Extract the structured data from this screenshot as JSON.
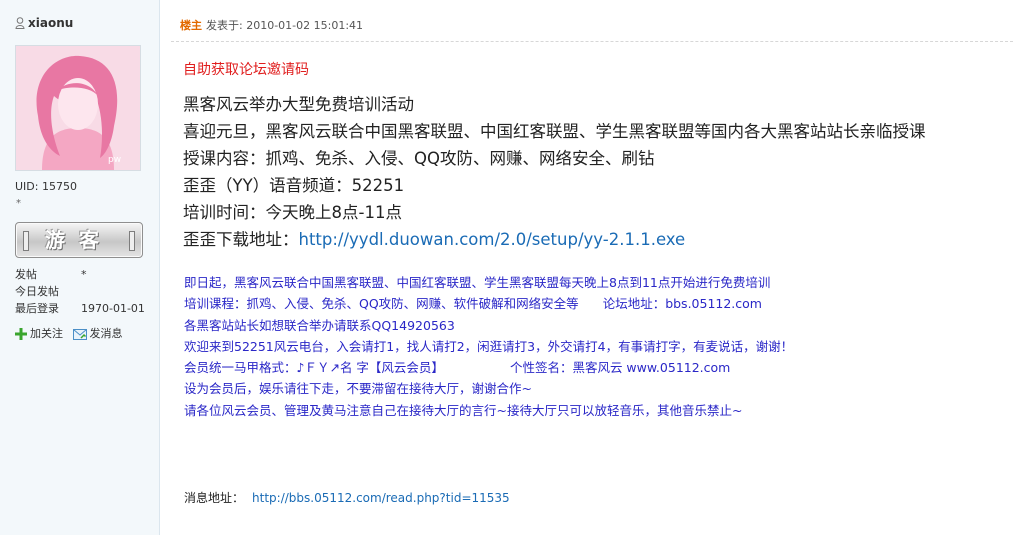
{
  "user": {
    "name": "xiaonu",
    "uid": "UID: 15750",
    "star": "*",
    "rank_badge": "游客",
    "stats": [
      {
        "label": "发帖",
        "value": "*"
      },
      {
        "label": "今日发帖",
        "value": ""
      },
      {
        "label": "最后登录",
        "value": "1970-01-01"
      }
    ],
    "actions": {
      "follow": "加关注",
      "message": "发消息"
    },
    "avatar_watermark": "pw"
  },
  "post": {
    "owner_tag": "楼主",
    "posted_at": "发表于: 2010-01-02 15:01:41",
    "title": "自助获取论坛邀请码",
    "lines": [
      "黑客风云举办大型免费培训活动",
      "喜迎元旦，黑客风云联合中国黑客联盟、中国红客联盟、学生黑客联盟等国内各大黑客站站长亲临授课",
      "授课内容：抓鸡、免杀、入侵、QQ攻防、网赚、网络安全、刷钻",
      "歪歪（YY）语音频道：52251",
      "培训时间：今天晚上8点-11点"
    ],
    "download_label": "歪歪下载地址：",
    "download_link": "http://yydl.duowan.com/2.0/setup/yy-2.1.1.exe",
    "blue": {
      "line1": "即日起，黑客风云联合中国黑客联盟、中国红客联盟、学生黑客联盟每天晚上8点到11点开始进行免费培训",
      "line2a": "培训课程：抓鸡、入侵、免杀、QQ攻防、网赚、软件破解和网络安全等",
      "line2b": "论坛地址：bbs.05112.com",
      "line3": "各黑客站站长如想联合举办请联系QQ14920563",
      "line4": "欢迎来到52251风云电台，入会请打1，找人请打2，闲逛请打3，外交请打4，有事请打字，有麦说话，谢谢！",
      "line5a": "会员统一马甲格式：♪ＦＹ↗名  字【风云会员】",
      "line5b": "个性签名：黑客风云 www.05112.com",
      "line6": "设为会员后，娱乐请往下走，不要滞留在接待大厅，谢谢合作~",
      "line7": "请各位风云会员、管理及黄马注意自己在接待大厅的言行~接待大厅只可以放轻音乐，其他音乐禁止~"
    },
    "news_label": "消息地址：",
    "news_link": "http://bbs.05112.com/read.php?tid=11535"
  }
}
